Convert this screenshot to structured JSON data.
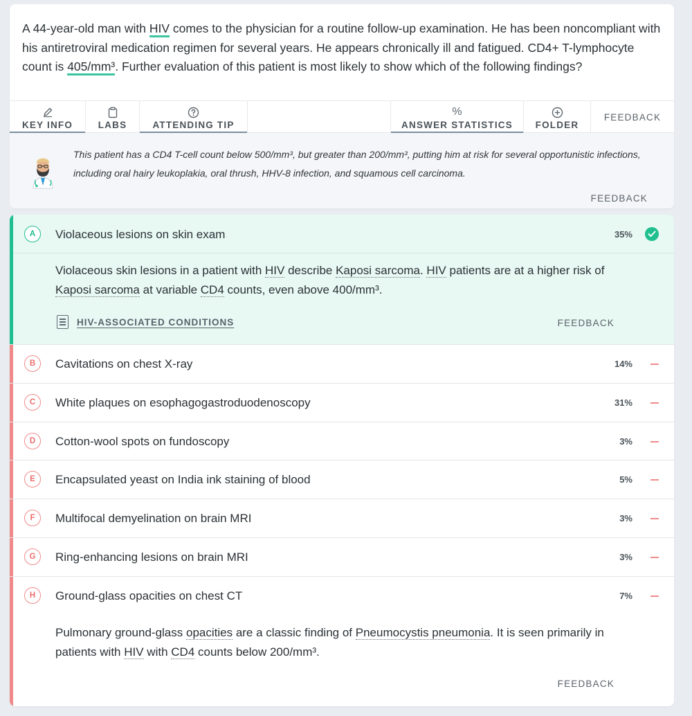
{
  "question": {
    "p1": "A 44-year-old man with ",
    "hiv": "HIV",
    "p2": " comes to the physician for a routine follow-up examination. He has been noncompliant with his antiretroviral medication regimen for several years. He appears chronically ill and fatigued. CD4+ T-lymphocyte count is ",
    "count": "405/mm³",
    "p3": ". Further evaluation of this patient is most likely to show which of the following findings?"
  },
  "tabs": {
    "key_info": "KEY INFO",
    "labs": "LABS",
    "attending_tip": "ATTENDING TIP",
    "answer_statistics": "ANSWER STATISTICS",
    "folder": "FOLDER",
    "feedback": "FEEDBACK"
  },
  "tip": {
    "text": "This patient has a CD4 T-cell count below 500/mm³, but greater than 200/mm³, putting him at risk for several opportunistic infections, including oral hairy leukoplakia, oral thrush, HHV-8 infection, and squamous cell carcinoma.",
    "feedback": "FEEDBACK"
  },
  "options": [
    {
      "letter": "A",
      "text": "Violaceous lesions on skin exam",
      "pct": "35%"
    },
    {
      "letter": "B",
      "text": "Cavitations on chest X-ray",
      "pct": "14%"
    },
    {
      "letter": "C",
      "text": "White plaques on esophagogastroduodenoscopy",
      "pct": "31%"
    },
    {
      "letter": "D",
      "text": "Cotton-wool spots on fundoscopy",
      "pct": "3%"
    },
    {
      "letter": "E",
      "text": "Encapsulated yeast on India ink staining of blood",
      "pct": "5%"
    },
    {
      "letter": "F",
      "text": "Multifocal demyelination on brain MRI",
      "pct": "3%"
    },
    {
      "letter": "G",
      "text": "Ring-enhancing lesions on brain MRI",
      "pct": "3%"
    },
    {
      "letter": "H",
      "text": "Ground-glass opacities on chest CT",
      "pct": "7%"
    }
  ],
  "explain_a": {
    "s1": "Violaceous skin lesions in a patient with ",
    "l1": "HIV",
    "s2": " describe ",
    "l2": "Kaposi sarcoma",
    "s3": ". ",
    "l3": "HIV",
    "s4": " patients are at a higher risk of ",
    "l4": "Kaposi sarcoma",
    "s5": " at variable ",
    "l5": "CD4",
    "s6": " counts, even above 400/mm³.",
    "link": "HIV-ASSOCIATED CONDITIONS",
    "feedback": "FEEDBACK"
  },
  "explain_h": {
    "s1": "Pulmonary ground-glass ",
    "l1": "opacities",
    "s2": " are a classic finding of ",
    "l2": "Pneumocystis pneumonia",
    "s3": ". It is seen primarily in patients with ",
    "l3": "HIV",
    "s4": " with ",
    "l4": "CD4",
    "s5": " counts below 200/mm³.",
    "feedback": "FEEDBACK"
  },
  "colors": {
    "correct": "#1fbf8f",
    "incorrect": "#f08a8a",
    "underline": "#3cc4a0",
    "tab_bar": "#7b8e9d"
  }
}
